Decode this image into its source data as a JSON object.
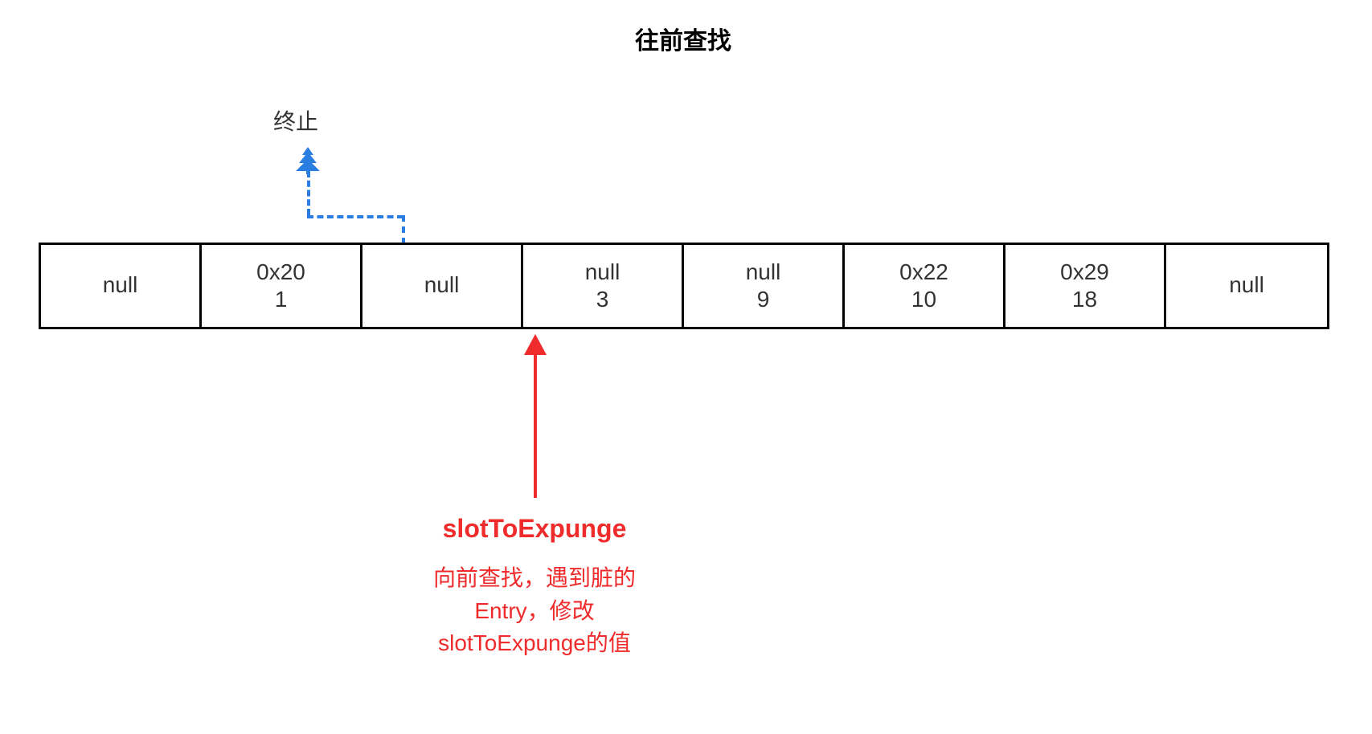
{
  "topArrowLabel": "往前查找",
  "terminateLabel": "终止",
  "cells": [
    {
      "line1": "null",
      "line2": ""
    },
    {
      "line1": "0x20",
      "line2": "1"
    },
    {
      "line1": "null",
      "line2": ""
    },
    {
      "line1": "null",
      "line2": "3"
    },
    {
      "line1": "null",
      "line2": "9"
    },
    {
      "line1": "0x22",
      "line2": "10"
    },
    {
      "line1": "0x29",
      "line2": "18"
    },
    {
      "line1": "null",
      "line2": ""
    }
  ],
  "pointerTitle": "slotToExpunge",
  "pointerDesc1": "向前查找，遇到脏的",
  "pointerDesc2": "Entry，修改",
  "pointerDesc3": "slotToExpunge的值"
}
